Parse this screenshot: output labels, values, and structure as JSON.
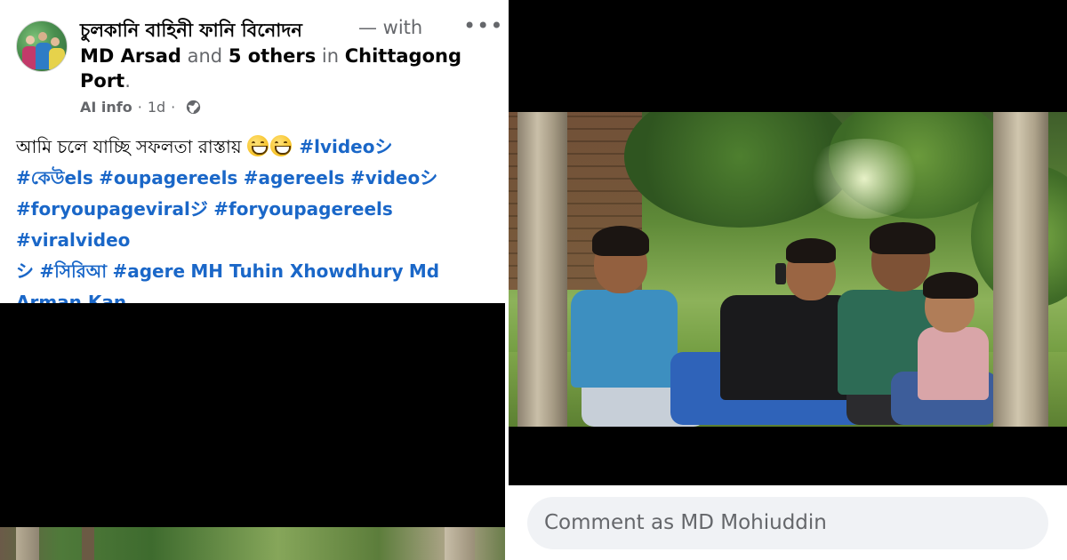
{
  "post": {
    "page_name": "চুলকানি বাহিনী ফানি বিনোদন",
    "with_label": " — with",
    "tagged_user": "MD Arsad",
    "and_label": " and ",
    "others_label": "5 others",
    "in_label": " in ",
    "location_line1": "Chittagong",
    "location_line2": "Port",
    "period": ".",
    "ai_info": "AI info",
    "meta_separator": "·",
    "time_ago": "1d",
    "audience_icon": "globe-icon",
    "more_icon": "more-options-icon",
    "more_label": "•••"
  },
  "caption": {
    "text": "আমি চলে যাচ্ছি সফলতা রাস্তায় ",
    "emoji_name": "grinning-squinting-face-emoji",
    "hashtags": [
      "#lvideoシ",
      "#কেউels",
      "#oupagereels",
      "#agereels",
      "#videoシ",
      "#foryoupageviralジ",
      "#foryoupagereels",
      "#viralvideo",
      "シ",
      "#সিরিআ",
      "#agere",
      "MH Tuhin Xhowdhury",
      "Md",
      "Arman Kan"
    ]
  },
  "comment": {
    "placeholder": "Comment as MD Mohiuddin"
  },
  "colors": {
    "hashtag": "#1a67c8",
    "text_primary": "#050505",
    "text_secondary": "#65676b",
    "comment_bg": "#f0f2f5",
    "video_bg": "#000000"
  }
}
